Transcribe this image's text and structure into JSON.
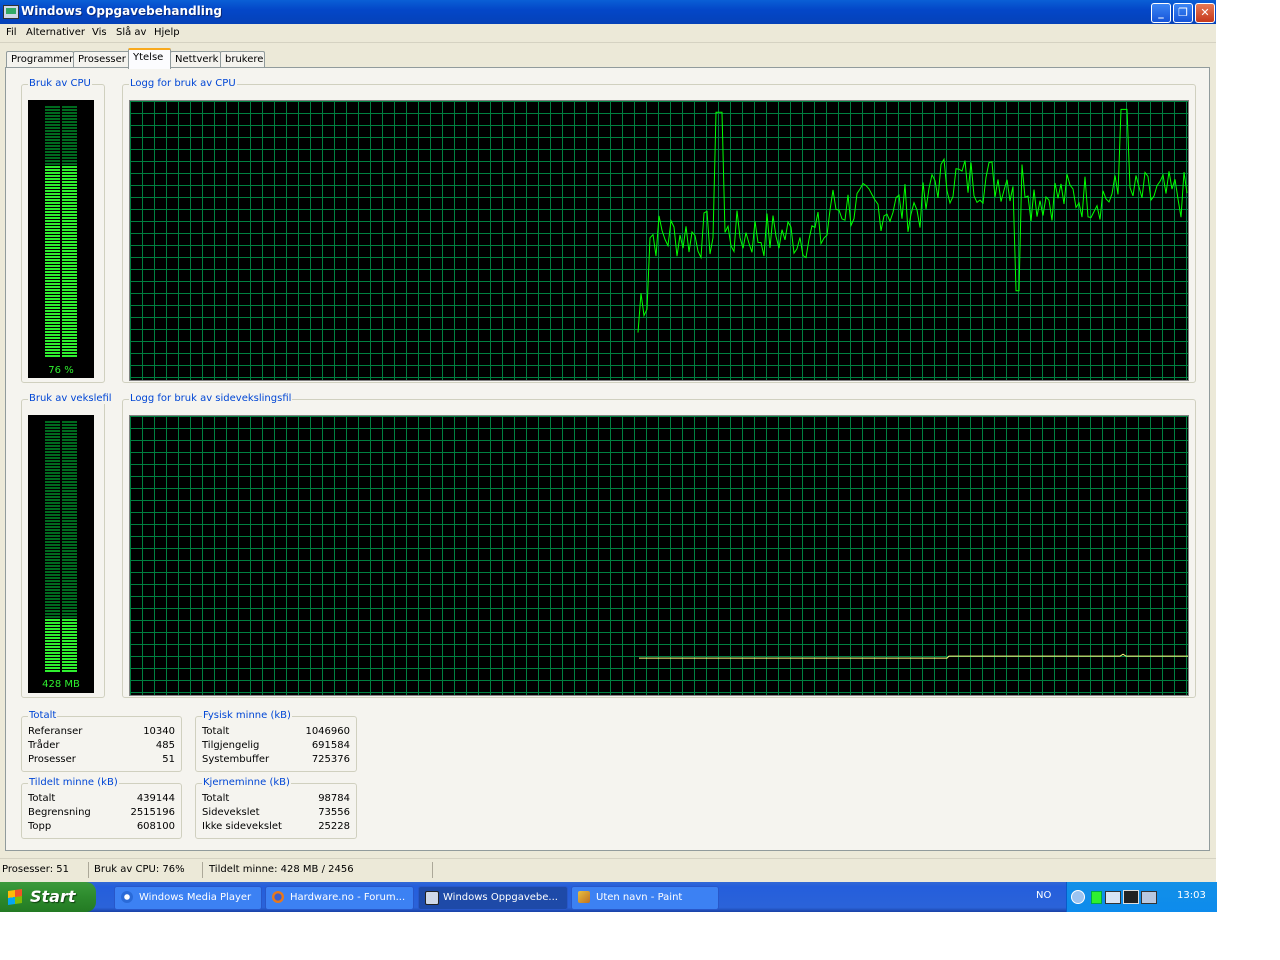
{
  "window": {
    "title": "Windows Oppgavebehandling",
    "controls": {
      "minimize": "_",
      "restore": "❐",
      "close": "✕"
    }
  },
  "menu": [
    "Fil",
    "Alternativer",
    "Vis",
    "Slå av",
    "Hjelp"
  ],
  "tabs": [
    "Programmer",
    "Prosesser",
    "Ytelse",
    "Nettverk",
    "brukere"
  ],
  "active_tab": "Ytelse",
  "cpu_usage": {
    "label": "Bruk av CPU",
    "value_text": "76 %",
    "percent": 76
  },
  "cpu_history": {
    "label": "Logg for bruk av CPU"
  },
  "pagefile_usage": {
    "label": "Bruk av vekslefil",
    "value_text": "428 MB",
    "fraction": 0.22
  },
  "pagefile_history": {
    "label": "Logg for bruk av sidevekslingsfil"
  },
  "totals": {
    "title": "Totalt",
    "rows": [
      {
        "k": "Referanser",
        "v": "10340"
      },
      {
        "k": "Tråder",
        "v": "485"
      },
      {
        "k": "Prosesser",
        "v": "51"
      }
    ]
  },
  "physical_memory": {
    "title": "Fysisk minne (kB)",
    "rows": [
      {
        "k": "Totalt",
        "v": "1046960"
      },
      {
        "k": "Tilgjengelig",
        "v": "691584"
      },
      {
        "k": "Systembuffer",
        "v": "725376"
      }
    ]
  },
  "commit_charge": {
    "title": "Tildelt minne (kB)",
    "rows": [
      {
        "k": "Totalt",
        "v": "439144"
      },
      {
        "k": "Begrensning",
        "v": "2515196"
      },
      {
        "k": "Topp",
        "v": "608100"
      }
    ]
  },
  "kernel_memory": {
    "title": "Kjerneminne (kB)",
    "rows": [
      {
        "k": "Totalt",
        "v": "98784"
      },
      {
        "k": "Sidevekslet",
        "v": "73556"
      },
      {
        "k": "Ikke sidevekslet",
        "v": "25228"
      }
    ]
  },
  "statusbar": {
    "processes": "Prosesser: 51",
    "cpu": "Bruk av CPU: 76%",
    "commit": "Tildelt minne: 428 MB / 2456"
  },
  "taskbar": {
    "start": "Start",
    "tasks": [
      "Windows Media Player",
      "Hardware.no - Forum...",
      "Windows Oppgavebe...",
      "Uten navn - Paint"
    ],
    "lang": "NO",
    "clock": "13:03"
  },
  "colors": {
    "graph_line": "#00ff00",
    "grid": "#008040",
    "meter_on": "#2ff02f",
    "pagefile_line": "#ffff80"
  }
}
